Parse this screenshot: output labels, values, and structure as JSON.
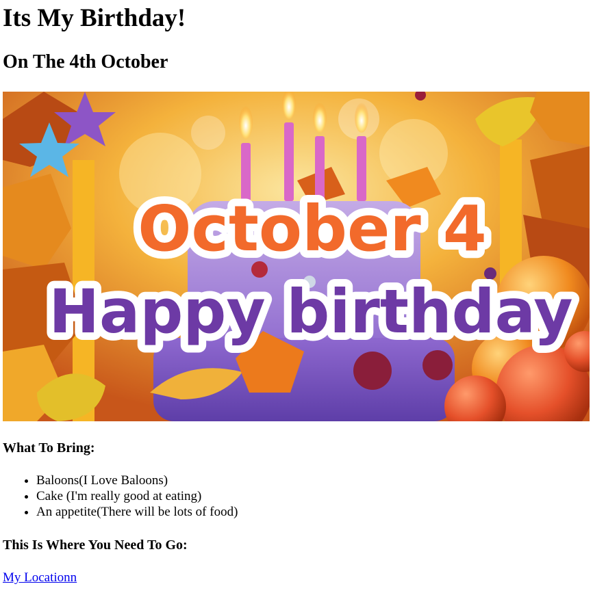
{
  "page": {
    "title": "Its My Birthday!",
    "subtitle": "On The 4th October"
  },
  "banner": {
    "line1": "October 4",
    "line2": "Happy birthday",
    "colors": {
      "orange_text": "#f26a2b",
      "purple_text": "#6d3aa5",
      "candle": "#d968c8",
      "cake_top": "#a98ad6",
      "cake_bottom": "#7a55c0",
      "background_warm": "#f3a93b"
    }
  },
  "bring": {
    "heading": "What To Bring:",
    "items": [
      "Baloons(I Love Baloons)",
      "Cake (I'm really good at eating)",
      "An appetite(There will be lots of food)"
    ]
  },
  "location": {
    "heading": "This Is Where You Need To Go:",
    "link_text": "My Locationn"
  }
}
